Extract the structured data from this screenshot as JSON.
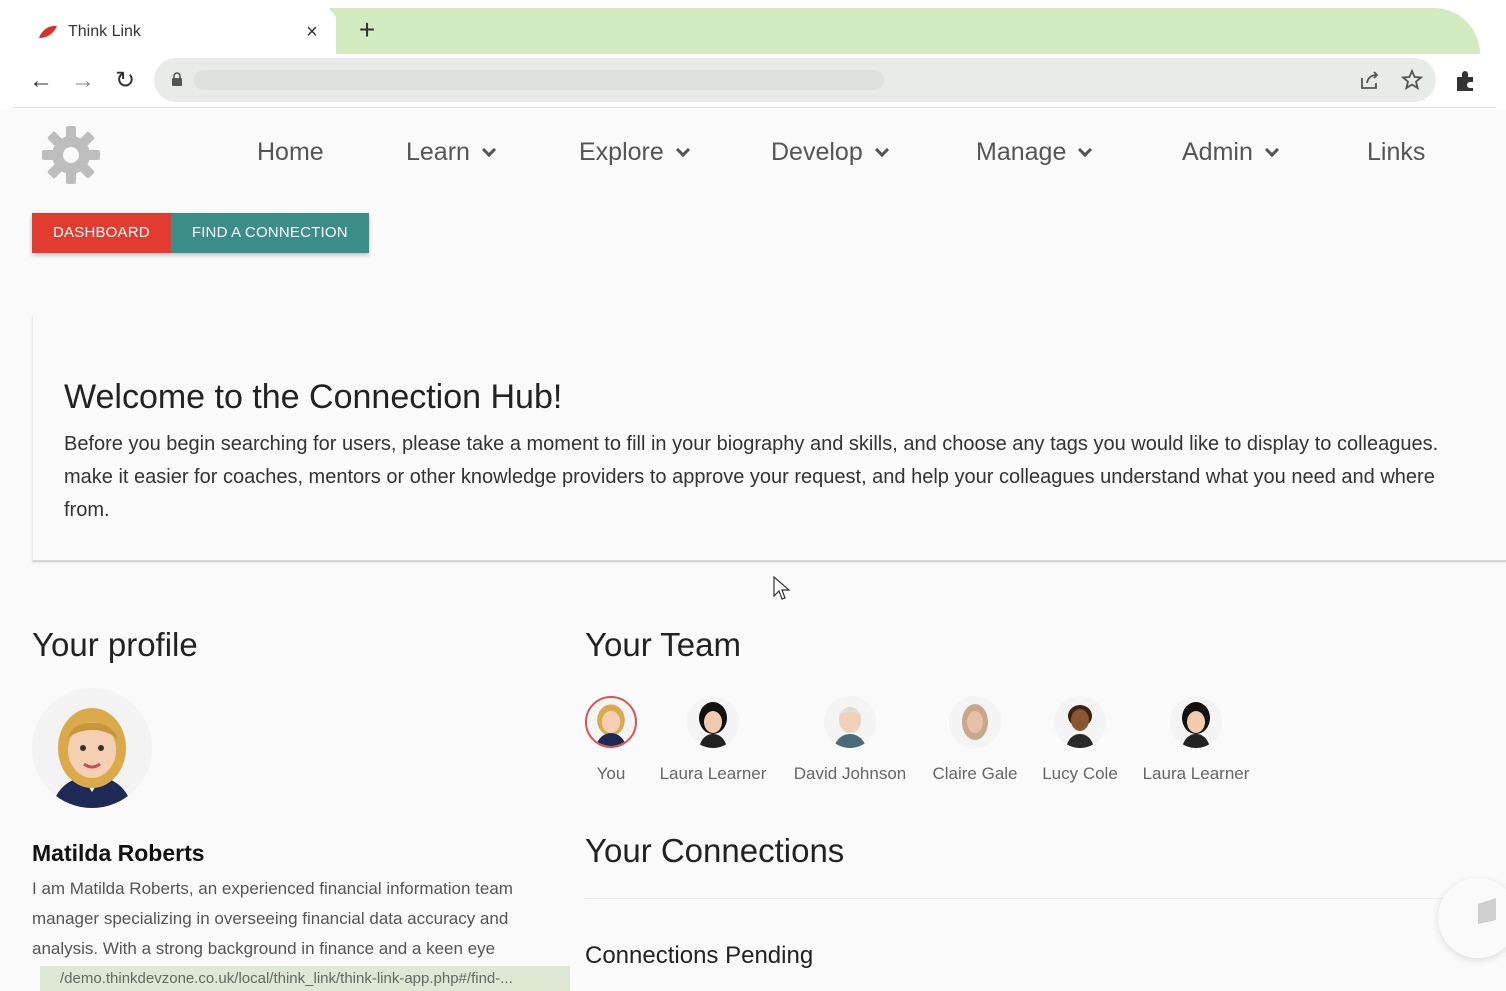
{
  "browser": {
    "tab_title": "Think Link",
    "tab_close": "×",
    "new_tab": "+",
    "back": "←",
    "forward": "→",
    "reload": "↻"
  },
  "nav": {
    "home": "Home",
    "learn": "Learn",
    "explore": "Explore",
    "develop": "Develop",
    "manage": "Manage",
    "admin": "Admin",
    "links": "Links"
  },
  "subtabs": {
    "dashboard": "DASHBOARD",
    "find_connection": "FIND A CONNECTION"
  },
  "welcome": {
    "title": "Welcome to the Connection Hub!",
    "line1": "Before you begin searching for users, please take a moment to fill in your biography and skills, and choose any tags you would like to display to colleagues.",
    "line2": "make it easier for coaches, mentors or other knowledge providers to approve your request, and help your colleagues understand what you need and where",
    "line3": "from."
  },
  "profile": {
    "section_title": "Your profile",
    "name": "Matilda Roberts",
    "bio": "I am Matilda Roberts, an experienced financial information team manager specializing in overseeing financial data accuracy and analysis. With a strong background in finance and a keen eye"
  },
  "team": {
    "section_title": "Your Team",
    "members": [
      {
        "name": "You"
      },
      {
        "name": "Laura Learner"
      },
      {
        "name": "David Johnson"
      },
      {
        "name": "Claire Gale"
      },
      {
        "name": "Lucy Cole"
      },
      {
        "name": "Laura Learner"
      }
    ]
  },
  "connections": {
    "section_title": "Your Connections",
    "pending_title": "Connections Pending"
  },
  "status_bar": {
    "url": "/demo.thinkdevzone.co.uk/local/think_link/think-link-app.php#/find-..."
  },
  "colors": {
    "tab_green": "#d4eac0",
    "dashboard_red": "#e23b30",
    "find_teal": "#3b8d88"
  }
}
